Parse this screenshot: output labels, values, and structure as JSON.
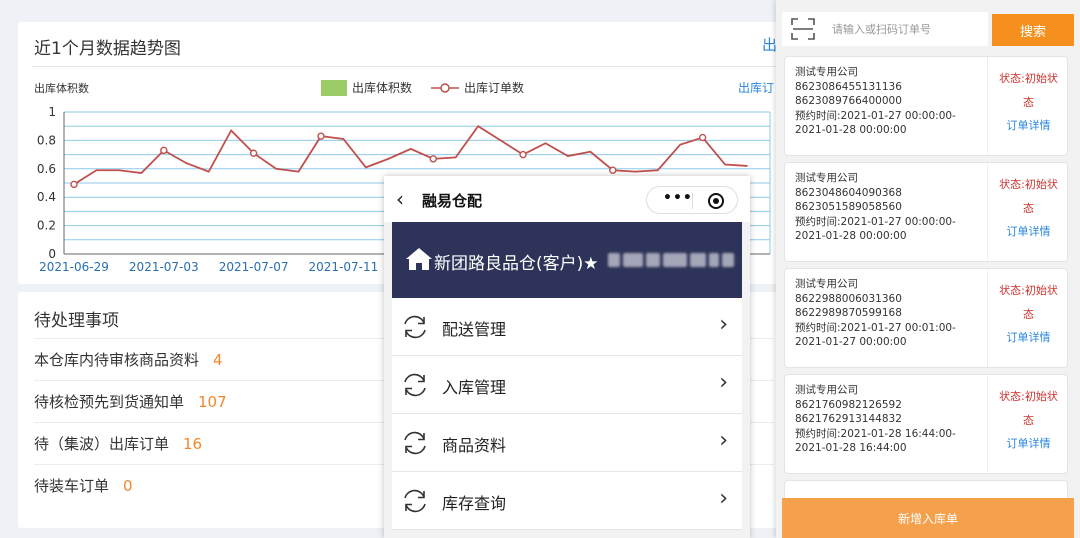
{
  "header": {
    "title": ""
  },
  "trend": {
    "title": "近1个月数据趋势图",
    "corner_link": "出",
    "legend_link": "出库订",
    "legend": {
      "volume": "出库体积数",
      "orders": "出库订单数"
    }
  },
  "chart_data": {
    "type": "line",
    "title": "",
    "ylabel": "出库体积数",
    "xlabel": "",
    "ylim": [
      0,
      1
    ],
    "yticks": [
      "0",
      "0.2",
      "0.4",
      "0.6",
      "0.8",
      "1"
    ],
    "x_tick_labels": [
      "2021-06-29",
      "2021-07-03",
      "2021-07-07",
      "2021-07-11"
    ],
    "x": [
      "2021-06-29",
      "2021-06-30",
      "2021-07-01",
      "2021-07-02",
      "2021-07-03",
      "2021-07-04",
      "2021-07-05",
      "2021-07-06",
      "2021-07-07",
      "2021-07-08",
      "2021-07-09",
      "2021-07-10",
      "2021-07-11",
      "2021-07-12",
      "2021-07-13",
      "2021-07-14",
      "2021-07-15",
      "2021-07-16",
      "2021-07-17",
      "2021-07-18",
      "2021-07-19",
      "2021-07-20",
      "2021-07-21",
      "2021-07-22",
      "2021-07-23",
      "2021-07-24",
      "2021-07-25",
      "2021-07-26",
      "2021-07-27",
      "2021-07-28",
      "2021-07-29",
      "2021-07-30"
    ],
    "series": [
      {
        "name": "出库订单数",
        "values": [
          0.49,
          0.59,
          0.59,
          0.57,
          0.73,
          0.64,
          0.58,
          0.87,
          0.71,
          0.6,
          0.58,
          0.83,
          0.81,
          0.61,
          0.67,
          0.74,
          0.67,
          0.68,
          0.9,
          0.8,
          0.7,
          0.78,
          0.69,
          0.72,
          0.59,
          0.58,
          0.59,
          0.77,
          0.82,
          0.63,
          0.62
        ]
      },
      {
        "name": "出库体积数",
        "values": []
      }
    ],
    "grid": true,
    "legend_position": "top"
  },
  "pending": {
    "title": "待处理事项",
    "items": [
      {
        "label": "本仓库内待审核商品资料",
        "count": "4"
      },
      {
        "label": "待核检预先到货通知单",
        "count": "107"
      },
      {
        "label": "待（集波）出库订单",
        "count": "16"
      },
      {
        "label": "待装车订单",
        "count": "0"
      }
    ]
  },
  "miniapp": {
    "title": "融易仓配",
    "back_icon": "back-chevron-icon",
    "warehouse": "新团路良品仓(客户)★",
    "menu": [
      {
        "label": "配送管理",
        "icon": "refresh-icon"
      },
      {
        "label": "入库管理",
        "icon": "refresh-icon"
      },
      {
        "label": "商品资料",
        "icon": "refresh-icon"
      },
      {
        "label": "库存查询",
        "icon": "refresh-icon"
      }
    ]
  },
  "orders": {
    "search_placeholder": "请输入或扫码订单号",
    "search_button": "搜索",
    "detail_link": "订单详情",
    "new_button": "新增入库单",
    "list": [
      {
        "company": "测试专用公司",
        "no1": "8623086455131136",
        "no2": "8623089766400000",
        "time": "预约时间:2021-01-27 00:00:00-2021-01-28 00:00:00",
        "status": "状态:初始状态"
      },
      {
        "company": "测试专用公司",
        "no1": "8623048604090368",
        "no2": "8623051589058560",
        "time": "预约时间:2021-01-27 00:00:00-2021-01-28 00:00:00",
        "status": "状态:初始状态"
      },
      {
        "company": "测试专用公司",
        "no1": "8622988006031360",
        "no2": "8622989870599168",
        "time": "预约时间:2021-01-27 00:01:00-2021-01-27 00:00:00",
        "status": "状态:初始状态"
      },
      {
        "company": "测试专用公司",
        "no1": "8621760982126592",
        "no2": "8621762913144832",
        "time": "预约时间:2021-01-28 16:44:00-2021-01-28 16:44:00",
        "status": "状态:初始状态"
      }
    ]
  },
  "colors": {
    "accent": "#f5901e",
    "navy": "#2e3459",
    "link": "#2a86e0",
    "status": "#d0312d",
    "line": "#c0504d",
    "legend_bar": "#9ccc65"
  }
}
